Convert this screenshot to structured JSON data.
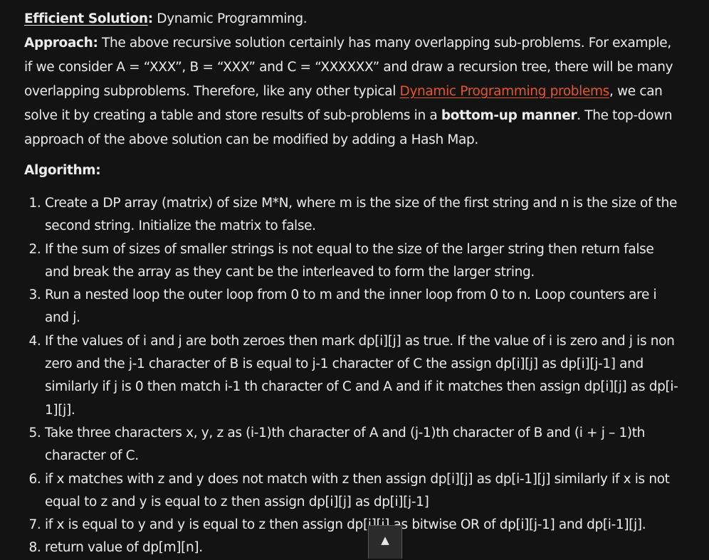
{
  "efficient": {
    "label": "Efficient Solution",
    "colon": ":",
    "value": " Dynamic Programming."
  },
  "approach": {
    "label": "Approach:",
    "text1": " The above recursive solution certainly has many overlapping sub-problems. For example, if we consider A = “XXX”, B = “XXX” and C = “XXXXXX” and draw a recursion tree, there will be many overlapping subproblems. Therefore, like any other typical ",
    "link": "Dynamic Programming problems",
    "text2": ", we can solve it by creating a table and store results of sub-problems in a ",
    "bold": "bottom-up manner",
    "text3": ". The top-down approach of the above solution can be modified by adding a Hash Map."
  },
  "algorithm": {
    "heading": "Algorithm:",
    "steps": [
      "Create a DP array (matrix) of size M*N, where m is the size of the first string and n is the size of the second string. Initialize the matrix to false.",
      "If the sum of sizes of smaller strings is not equal to the size of the larger string then return false and break the array as they cant be the interleaved to form the larger string.",
      "Run a nested loop the outer loop from 0 to m and the inner loop from 0 to n. Loop counters are i and j.",
      "If the values of i and j are both zeroes then mark dp[i][j] as true. If the value of i is zero and j is non zero and the j-1 character of B is equal to j-1 character of C the assign dp[i][j] as dp[i][j-1] and similarly if j is 0 then match i-1 th character of C and A and if it matches then assign dp[i][j] as dp[i-1][j].",
      "Take three characters x, y, z as (i-1)th character of A and (j-1)th character of B and (i + j – 1)th character of C.",
      "if x matches with z and y does not match with z then assign dp[i][j] as dp[i-1][j] similarly if x is not equal to z and y is equal to z then assign dp[i][j] as dp[i][j-1]",
      "if x is equal to y and y is equal to z then assign dp[i][j] as bitwise OR of dp[i][j-1] and dp[i-1][j].",
      "return value of dp[m][n]."
    ]
  },
  "scroll_top": {
    "icon": "▲"
  }
}
